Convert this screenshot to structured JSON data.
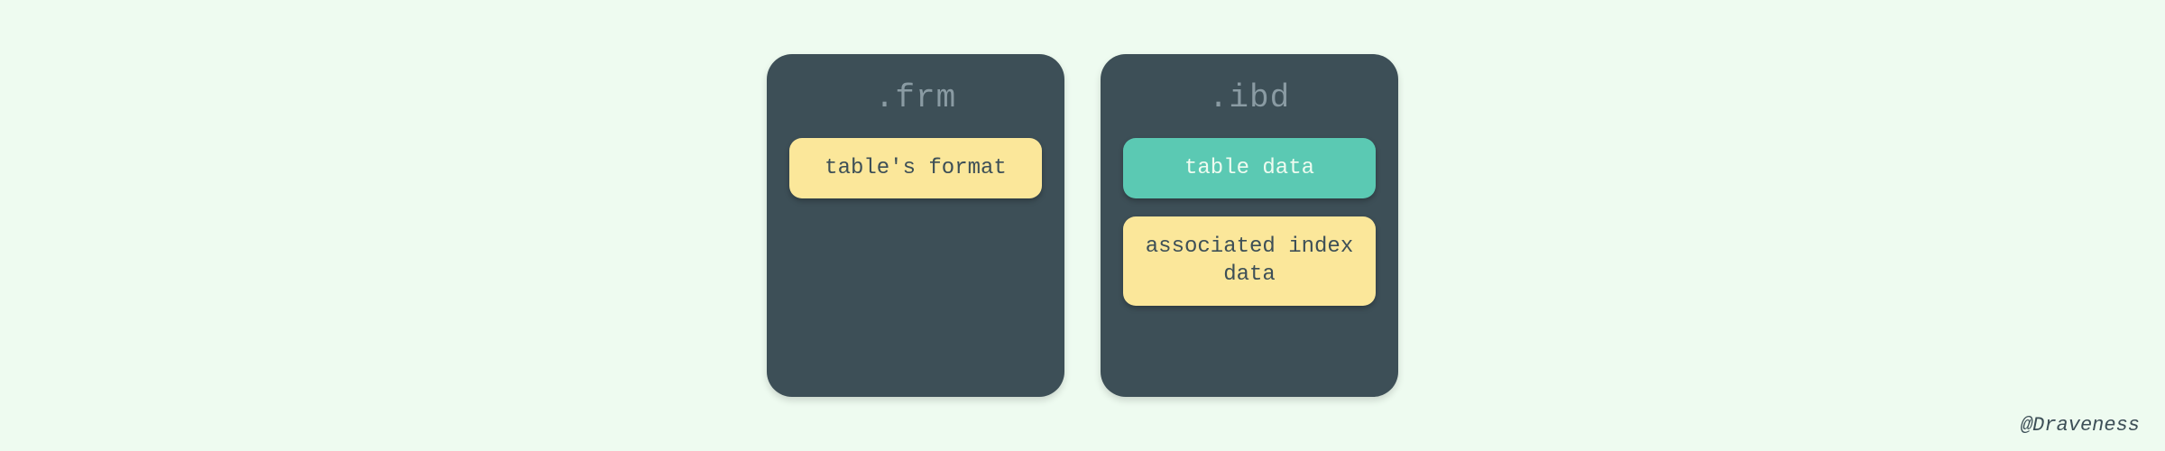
{
  "boxes": {
    "frm": {
      "title": ".frm",
      "items": [
        {
          "label": "table's format",
          "style": "yellow"
        }
      ]
    },
    "ibd": {
      "title": ".ibd",
      "items": [
        {
          "label": "table data",
          "style": "teal"
        },
        {
          "label": "associated index data",
          "style": "yellow"
        }
      ]
    }
  },
  "attribution": "@Draveness",
  "colors": {
    "background": "#eefbf0",
    "boxBackground": "#3d4f57",
    "titleText": "#8a9ba3",
    "yellowPill": "#fbe79a",
    "tealPill": "#5bc9b3",
    "pillTextDark": "#3d4f57",
    "pillTextLight": "#eefbf0"
  }
}
